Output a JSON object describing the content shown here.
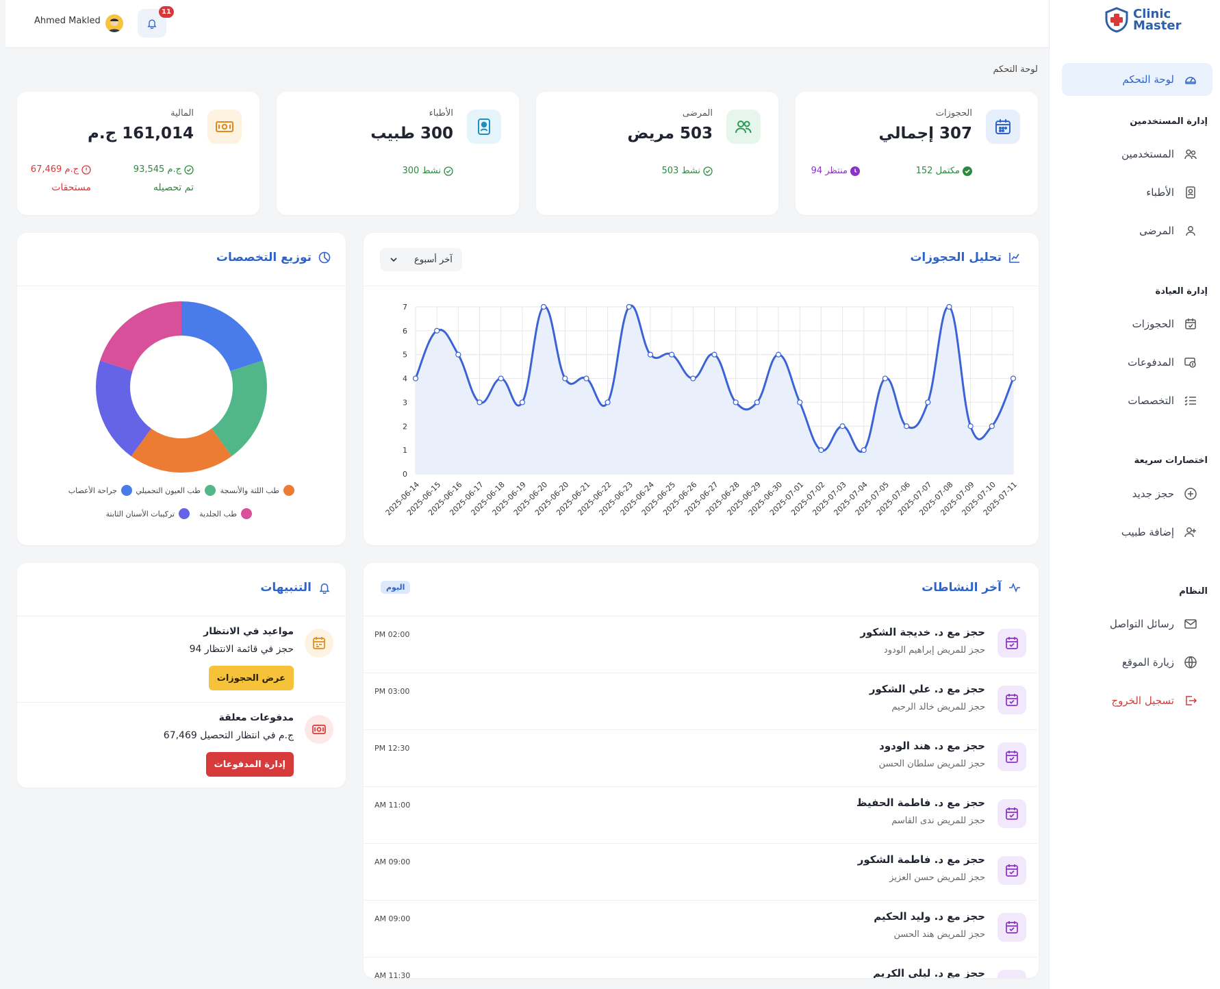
{
  "brand": {
    "name_line1": "Clinic",
    "name_line2": "Master",
    "color": "#2f5fa8"
  },
  "header": {
    "user_name": "Ahmed Makled",
    "notification_count": "11"
  },
  "breadcrumb": "لوحة التحكم",
  "sidebar": {
    "dashboard": "لوحة التحكم",
    "section_users": "إدارة المستخدمين",
    "users": "المستخدمين",
    "doctors": "الأطباء",
    "patients": "المرضى",
    "section_clinic": "إدارة العيادة",
    "bookings": "الحجوزات",
    "payments": "المدفوعات",
    "specialties": "التخصصات",
    "section_shortcuts": "اختصارات سريعة",
    "new_booking": "حجز جديد",
    "add_doctor": "إضافة طبيب",
    "section_system": "النظام",
    "messages": "رسائل التواصل",
    "visit_site": "زيارة الموقع",
    "logout": "تسجيل الخروج"
  },
  "stats": {
    "bookings": {
      "label": "الحجوزات",
      "value": "307 إجمالي",
      "completed": "152 مكتمل",
      "pending": "94 منتظر"
    },
    "patients": {
      "label": "المرضى",
      "value": "503 مريض",
      "active": "503 نشط"
    },
    "doctors": {
      "label": "الأطباء",
      "value": "300 طبيب",
      "active": "300 نشط"
    },
    "finance": {
      "label": "المالية",
      "value": "161,014 ج.م",
      "collected_amount": "93,545 ج.م",
      "collected_label": "تم تحصيله",
      "due_amount": "67,469 ج.م",
      "due_label": "مستحقات"
    }
  },
  "booking_chart": {
    "title": "تحليل الحجوزات",
    "range_select": "آخر أسبوع"
  },
  "specialty_chart": {
    "title": "توزيع التخصصات"
  },
  "chart_data": [
    {
      "type": "area",
      "title": "تحليل الحجوزات",
      "x": [
        "2025-06-14",
        "2025-06-15",
        "2025-06-16",
        "2025-06-17",
        "2025-06-18",
        "2025-06-19",
        "2025-06-20",
        "2025-06-20",
        "2025-06-21",
        "2025-06-22",
        "2025-06-23",
        "2025-06-24",
        "2025-06-25",
        "2025-06-26",
        "2025-06-27",
        "2025-06-28",
        "2025-06-29",
        "2025-06-30",
        "2025-07-01",
        "2025-07-02",
        "2025-07-03",
        "2025-07-04",
        "2025-07-05",
        "2025-07-06",
        "2025-07-07",
        "2025-07-08",
        "2025-07-09",
        "2025-07-10",
        "2025-07-11"
      ],
      "values": [
        4,
        6,
        5,
        3,
        4,
        3,
        7,
        4,
        4,
        3,
        7,
        5,
        5,
        4,
        5,
        3,
        3,
        5,
        3,
        1,
        2,
        1,
        4,
        2,
        3,
        7,
        2,
        2,
        4
      ],
      "ylim": [
        0,
        7
      ],
      "yticks": [
        0,
        1,
        2,
        3,
        4,
        5,
        6,
        7
      ],
      "grid": true,
      "color": "#3b63d6"
    },
    {
      "type": "pie",
      "title": "توزيع التخصصات",
      "categories": [
        "جراحة الأعصاب",
        "طب العيون التجميلي",
        "طب اللثة والأنسجة",
        "تركيبات الأسنان الثابتة",
        "طب الجلدية"
      ],
      "values": [
        20,
        20,
        20,
        20,
        20
      ],
      "colors": [
        "#4a7bea",
        "#52b788",
        "#ec7c34",
        "#6563e6",
        "#d9509a"
      ],
      "legend": "bottom"
    }
  ],
  "activities": {
    "title": "آخر النشاطات",
    "badge": "اليوم",
    "items": [
      {
        "title": "حجز مع د. خديجة الشكور",
        "sub": "حجز للمريض إبراهيم الودود",
        "time": "PM 02:00"
      },
      {
        "title": "حجز مع د. علي الشكور",
        "sub": "حجز للمريض خالد الرحيم",
        "time": "PM 03:00"
      },
      {
        "title": "حجز مع د. هند الودود",
        "sub": "حجز للمريض سلطان الحسن",
        "time": "PM 12:30"
      },
      {
        "title": "حجز مع د. فاطمة الحفيظ",
        "sub": "حجز للمريض ندى القاسم",
        "time": "AM 11:00"
      },
      {
        "title": "حجز مع د. فاطمة الشكور",
        "sub": "حجز للمريض حسن العزيز",
        "time": "AM 09:00"
      },
      {
        "title": "حجز مع د. وليد الحكيم",
        "sub": "حجز للمريض هند الحسن",
        "time": "AM 09:00"
      },
      {
        "title": "حجز مع د. ليلى الكريم",
        "sub": "",
        "time": "AM 11:30"
      }
    ]
  },
  "alerts": {
    "title": "التنبيهات",
    "items": [
      {
        "title": "مواعيد في الانتظار",
        "text": "94 حجز في قائمة الانتظار",
        "button": "عرض الحجوزات"
      },
      {
        "title": "مدفوعات معلقة",
        "text": "67,469 ج.م في انتظار التحصيل",
        "button": "إدارة المدفوعات"
      }
    ]
  }
}
